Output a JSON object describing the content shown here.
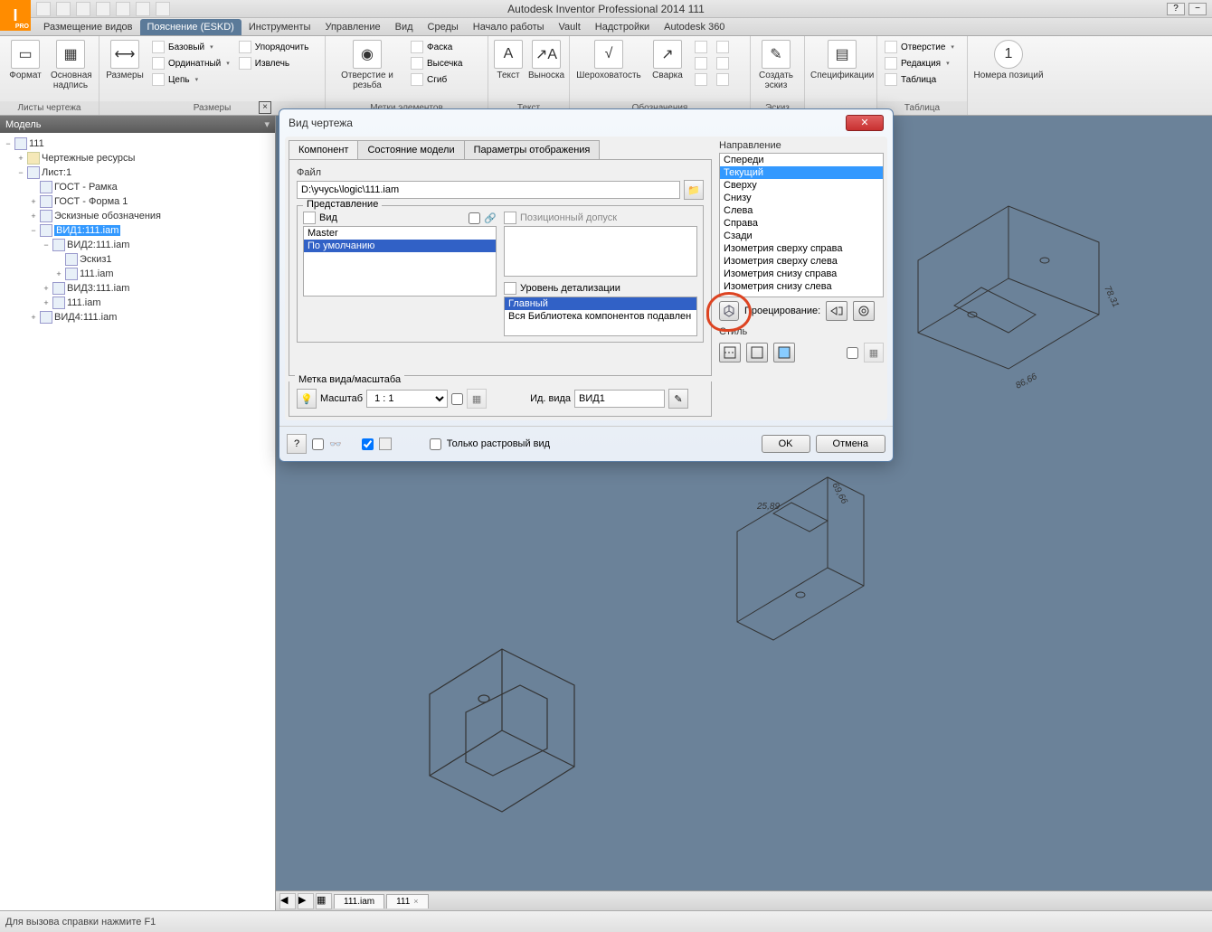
{
  "app": {
    "title": "Autodesk Inventor Professional 2014   111"
  },
  "tabs": [
    "Размещение видов",
    "Пояснение (ESKD)",
    "Инструменты",
    "Управление",
    "Вид",
    "Среды",
    "Начало работы",
    "Vault",
    "Надстройки",
    "Autodesk 360"
  ],
  "tabs_active_index": 1,
  "ribbon": {
    "groups": [
      {
        "label": "Листы чертежа",
        "big": [
          {
            "label": "Формат"
          },
          {
            "label": "Основная надпись"
          }
        ]
      },
      {
        "label": "Размеры",
        "big": [
          {
            "label": "Размеры"
          }
        ],
        "menu": [
          "Базовый",
          "Ординатный",
          "Цепь"
        ],
        "menu2": [
          "Упорядочить",
          "Извлечь"
        ]
      },
      {
        "label": "Метки элементов",
        "big": [
          {
            "label": "Отверстие и резьба"
          }
        ],
        "menu": [
          "Фаска",
          "Высечка",
          "Сгиб"
        ]
      },
      {
        "label": "Текст",
        "big": [
          {
            "label": "Текст"
          },
          {
            "label": "Выноска"
          }
        ]
      },
      {
        "label": "Обозначения",
        "big": [
          {
            "label": "Шероховатость"
          },
          {
            "label": "Сварка"
          }
        ]
      },
      {
        "label": "Эскиз",
        "big": [
          {
            "label": "Создать эскиз"
          }
        ]
      },
      {
        "label": "",
        "big": [
          {
            "label": "Спецификации"
          }
        ]
      },
      {
        "label": "Таблица",
        "menu": [
          "Отверстие",
          "Редакция",
          "Таблица"
        ]
      },
      {
        "label": "",
        "big": [
          {
            "label": "Номера позиций"
          }
        ]
      }
    ]
  },
  "panel": {
    "title": "Модель",
    "tree": {
      "root": "111",
      "items": [
        {
          "label": "Чертежные ресурсы",
          "lvl": 1,
          "exp": "+",
          "icon": "folder"
        },
        {
          "label": "Лист:1",
          "lvl": 1,
          "exp": "−",
          "icon": "doc"
        },
        {
          "label": "ГОСТ - Рамка",
          "lvl": 2,
          "exp": "",
          "icon": "doc"
        },
        {
          "label": "ГОСТ - Форма 1",
          "lvl": 2,
          "exp": "+",
          "icon": "doc"
        },
        {
          "label": "Эскизные обозначения",
          "lvl": 2,
          "exp": "+",
          "icon": "doc"
        },
        {
          "label": "ВИД1:111.iam",
          "lvl": 2,
          "exp": "−",
          "icon": "doc",
          "sel": true
        },
        {
          "label": "ВИД2:111.iam",
          "lvl": 3,
          "exp": "−",
          "icon": "doc"
        },
        {
          "label": "Эскиз1",
          "lvl": 4,
          "exp": "",
          "icon": "doc"
        },
        {
          "label": "111.iam",
          "lvl": 4,
          "exp": "+",
          "icon": "doc"
        },
        {
          "label": "ВИД3:111.iam",
          "lvl": 3,
          "exp": "+",
          "icon": "doc"
        },
        {
          "label": "111.iam",
          "lvl": 3,
          "exp": "+",
          "icon": "doc"
        },
        {
          "label": "ВИД4:111.iam",
          "lvl": 2,
          "exp": "+",
          "icon": "doc"
        }
      ]
    }
  },
  "doctabs": [
    {
      "label": "111.iam"
    },
    {
      "label": "111",
      "close": true
    }
  ],
  "statusbar": "Для вызова справки нажмите F1",
  "dialog": {
    "title": "Вид чертежа",
    "tabs": [
      "Компонент",
      "Состояние модели",
      "Параметры отображения"
    ],
    "tabs_active": 0,
    "file_label": "Файл",
    "file_value": "D:\\учусь\\logic\\111.iam",
    "representation_label": "Представление",
    "view_label": "Вид",
    "view_items": [
      "Master",
      "По умолчанию"
    ],
    "view_sel": 1,
    "positional_label": "Позиционный допуск",
    "detail_label": "Уровень детализации",
    "detail_items": [
      "Главный",
      "Вся Библиотека компонентов подавлен"
    ],
    "detail_sel": 0,
    "direction_label": "Направление",
    "directions": [
      "Спереди",
      "Текущий",
      "Сверху",
      "Снизу",
      "Слева",
      "Справа",
      "Сзади",
      "Изометрия сверху справа",
      "Изометрия сверху слева",
      "Изометрия снизу справа",
      "Изометрия снизу слева"
    ],
    "direction_sel": 1,
    "projection_label": "Проецирование:",
    "style_label": "Стиль",
    "scale_section": "Метка вида/масштаба",
    "scale_label": "Масштаб",
    "scale_value": "1 : 1",
    "viewid_label": "Ид. вида",
    "viewid_value": "ВИД1",
    "raster_label": "Только растровый вид",
    "ok": "OK",
    "cancel": "Отмена"
  },
  "canvas_dims": [
    "86,66",
    "78,31",
    "69,66",
    "25,89"
  ]
}
